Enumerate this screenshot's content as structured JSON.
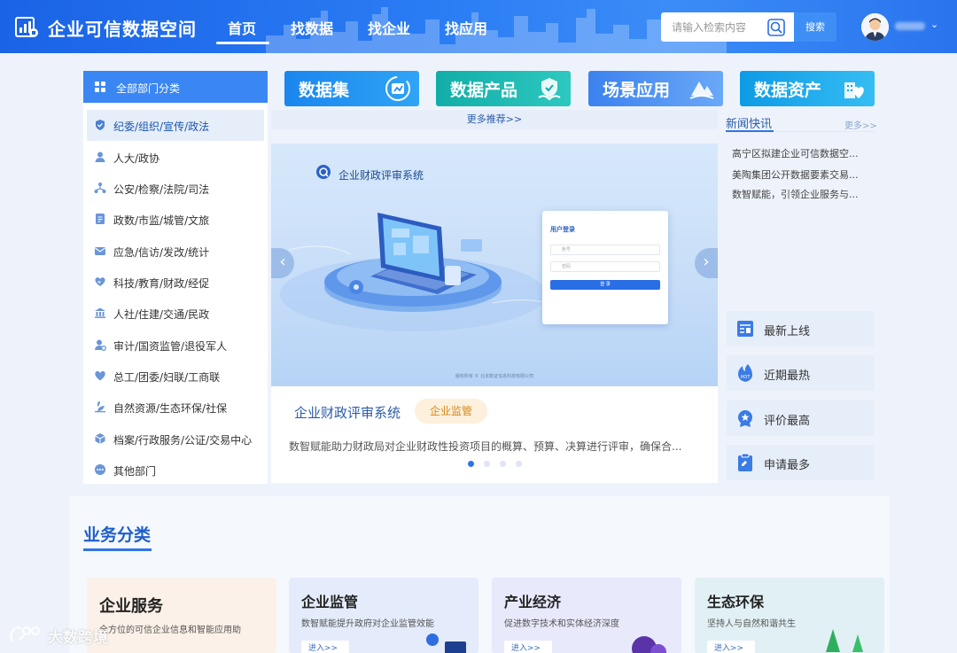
{
  "header": {
    "title": "企业可信数据空间",
    "nav": [
      "首页",
      "找数据",
      "找企业",
      "找应用"
    ],
    "search_placeholder": "请输入检索内容",
    "search_button": "搜索"
  },
  "sidebar": {
    "heading": "全部部门分类",
    "items": [
      {
        "label": "纪委/组织/宣传/政法",
        "icon": "shield-icon"
      },
      {
        "label": "人大/政协",
        "icon": "person-icon"
      },
      {
        "label": "公安/检察/法院/司法",
        "icon": "network-icon"
      },
      {
        "label": "政数/市监/城管/文旅",
        "icon": "document-icon"
      },
      {
        "label": "应急/信访/发改/统计",
        "icon": "mail-icon"
      },
      {
        "label": "科技/教育/财政/经促",
        "icon": "heart-hands-icon"
      },
      {
        "label": "人社/住建/交通/民政",
        "icon": "bank-icon"
      },
      {
        "label": "审计/国资监管/退役军人",
        "icon": "person-gear-icon"
      },
      {
        "label": "总工/团委/妇联/工商联",
        "icon": "heart-icon"
      },
      {
        "label": "自然资源/生态环保/社保",
        "icon": "leaf-icon"
      },
      {
        "label": "档案/行政服务/公证/交易中心",
        "icon": "cube-icon"
      },
      {
        "label": "其他部门",
        "icon": "more-icon"
      }
    ]
  },
  "categories": [
    {
      "label": "数据集",
      "color": "#1e8fef",
      "icon": "dataset-icon"
    },
    {
      "label": "数据产品",
      "color": "#18b7b0",
      "icon": "product-icon"
    },
    {
      "label": "场景应用",
      "color": "#4a8ef2",
      "icon": "scene-icon"
    },
    {
      "label": "数据资产",
      "color": "#16a6ea",
      "icon": "asset-icon"
    }
  ],
  "more_recommend": "更多推荐>>",
  "carousel": {
    "banner_title": "企业财政评审系统",
    "login_title": "用户登录",
    "login_user": "账号",
    "login_pass": "密码",
    "login_button": "登 录",
    "banner_footer": "版权所有 © 北京数证信息科技有限公司",
    "title": "企业财政评审系统",
    "badge": "企业监管",
    "description": "数智赋能助力财政局对企业财政性投资项目的概算、预算、决算进行评审，确保合...",
    "slide_count": 4,
    "active_slide": 1
  },
  "news": {
    "title": "新闻快讯",
    "more": "更多>>",
    "items": [
      "高宁区拟建企业可信数据空...",
      "美陶集团公开数据要素交易...",
      "数智赋能，引领企业服务与..."
    ]
  },
  "quick_links": [
    {
      "label": "最新上线",
      "icon": "list-icon"
    },
    {
      "label": "近期最热",
      "icon": "hot-icon"
    },
    {
      "label": "评价最高",
      "icon": "medal-icon"
    },
    {
      "label": "申请最多",
      "icon": "clipboard-icon"
    }
  ],
  "business": {
    "title": "业务分类",
    "cards": [
      {
        "title": "企业服务",
        "desc": "全方位的可信企业信息和智能应用助",
        "button": "",
        "bg": "#fcf1e8"
      },
      {
        "title": "企业监管",
        "desc": "数智赋能提升政府对企业监管效能",
        "button": "进入>>",
        "bg": "#e4ecfb"
      },
      {
        "title": "产业经济",
        "desc": "促进数字技术和实体经济深度",
        "button": "进入>>",
        "bg": "#e8e9fb"
      },
      {
        "title": "生态环保",
        "desc": "坚持人与自然和谐共生",
        "button": "进入>>",
        "bg": "#e1f0f4"
      }
    ]
  },
  "watermark": "大数跨境"
}
